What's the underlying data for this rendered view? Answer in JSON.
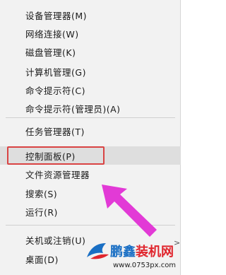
{
  "menu": {
    "top_partial": "",
    "items": [
      {
        "label": "设备管理器(M)"
      },
      {
        "label": "网络连接(W)"
      },
      {
        "label": "磁盘管理(K)"
      },
      {
        "label": "计算机管理(G)"
      },
      {
        "label": "命令提示符(C)"
      },
      {
        "label": "命令提示符(管理员)(A)"
      },
      {
        "label": "任务管理器(T)"
      },
      {
        "label": "控制面板(P)"
      },
      {
        "label": "文件资源管理器"
      },
      {
        "label": "搜索(S)"
      },
      {
        "label": "运行(R)"
      },
      {
        "label": "关机或注销(U)"
      },
      {
        "label": "桌面(D)"
      }
    ],
    "highlighted": "控制面板(P)",
    "submenu_glyph": ">"
  },
  "watermark": {
    "title_part1": "鹏鑫",
    "title_part2": "装机网",
    "url": "www.0753px.com"
  },
  "colors": {
    "highlight_box": "#d94343",
    "arrow": "#e23ad6",
    "menu_bg": "#f2f2f2",
    "brand_blue": "#1a6fc4",
    "brand_red": "#e0252d"
  }
}
